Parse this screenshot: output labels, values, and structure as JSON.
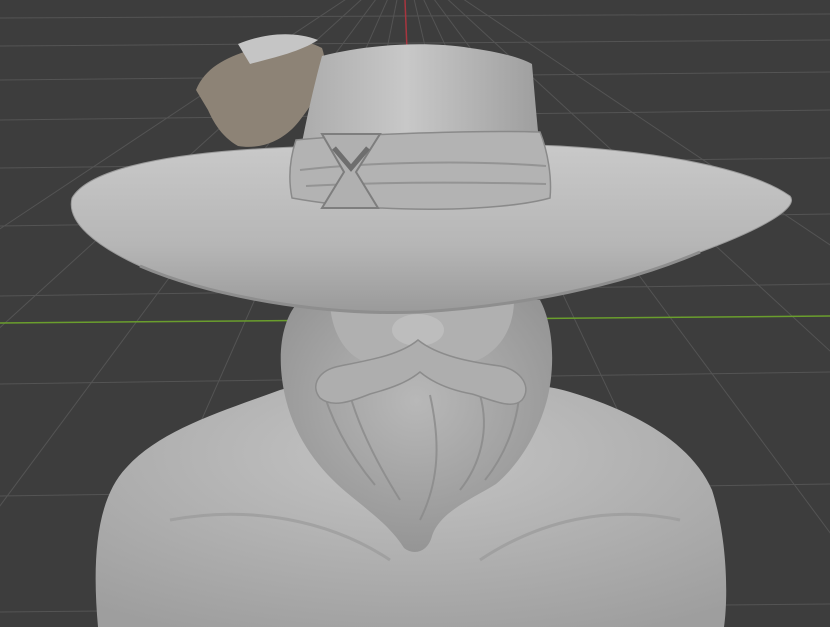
{
  "viewport": {
    "background_color": "#3d3d3d",
    "grid_color": "#545454",
    "x_axis_color": "#6a9e2d",
    "y_axis_color": "#a8353f",
    "model_color": "#b9b9b9"
  },
  "scene": {
    "object_name": "sculpt-bust-wide-brim-hat",
    "shading": "solid-gray"
  }
}
